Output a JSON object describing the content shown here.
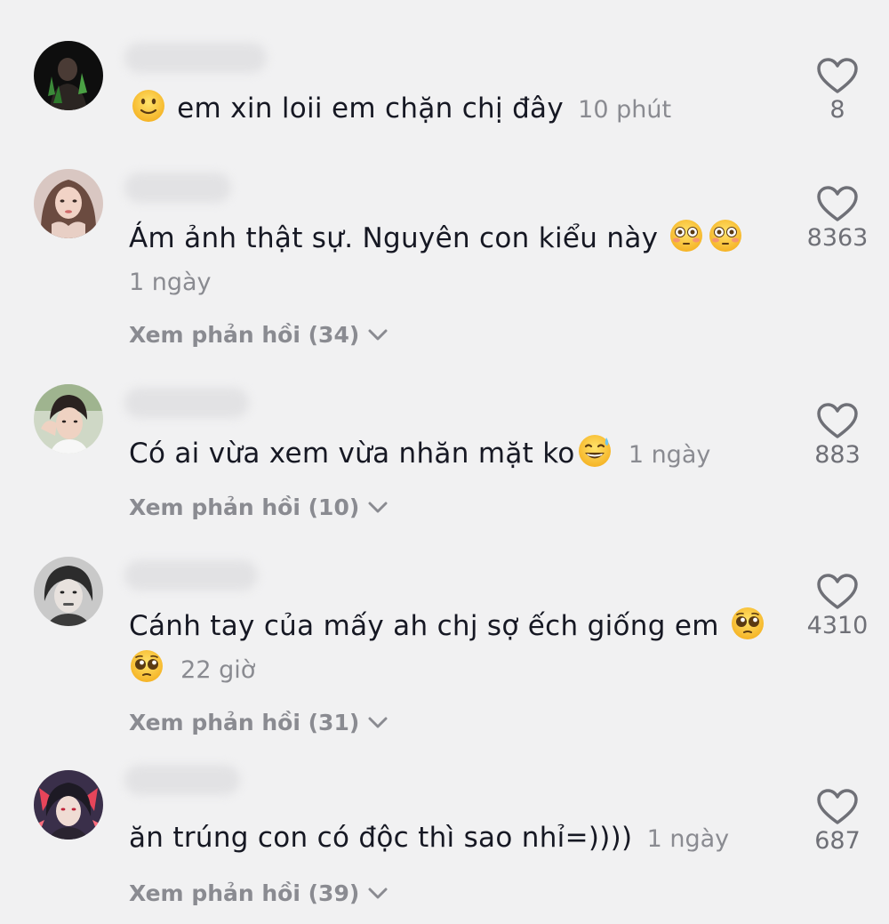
{
  "comments": [
    {
      "text_before": "",
      "lead_emoji": "slightly-smiling-face",
      "text": "em xin loii em chặn chị đây",
      "time": "10 phút",
      "likes": "8",
      "replies": ""
    },
    {
      "text": "Ám ảnh thật sự. Nguyên con kiểu này",
      "trailing_emoji": "flushed-face",
      "time": "1 ngày",
      "likes": "8363",
      "replies": "Xem phản hồi (34)"
    },
    {
      "text": "Có ai vừa xem vừa nhăn mặt ko",
      "trailing_emoji": "grinning-sweat-face",
      "time": "1 ngày",
      "likes": "883",
      "replies": "Xem phản hồi (10)"
    },
    {
      "text": "Cánh tay của mấy ah chj sợ ếch giống em",
      "trailing_emoji": "pleading-face",
      "time": "22 giờ",
      "likes": "4310",
      "replies": "Xem phản hồi (31)"
    },
    {
      "text": "ăn trúng con có độc thì sao nhỉ=))))",
      "time": "1 ngày",
      "likes": "687",
      "replies": "Xem phản hồi (39)"
    }
  ],
  "icons": {
    "like": "heart-outline-icon",
    "expand": "chevron-down-icon"
  },
  "colors": {
    "background": "#f1f1f2",
    "text": "#161823",
    "muted": "#8a8b91",
    "emoji": "#ffcc33"
  }
}
